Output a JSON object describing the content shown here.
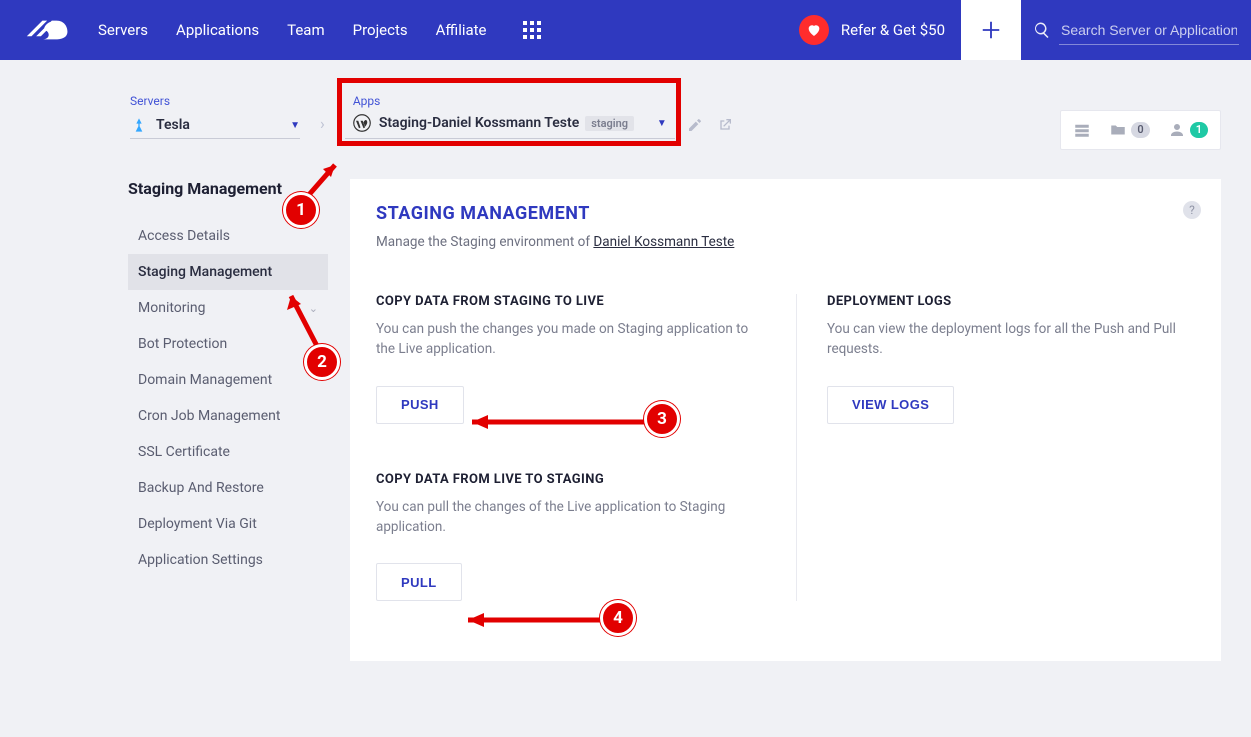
{
  "nav": {
    "links": [
      "Servers",
      "Applications",
      "Team",
      "Projects",
      "Affiliate"
    ],
    "refer_text": "Refer & Get $50",
    "search_placeholder": "Search Server or Application"
  },
  "breadcrumb": {
    "servers_label": "Servers",
    "server_name": "Tesla",
    "apps_label": "Apps",
    "app_name": "Staging-Daniel Kossmann Teste",
    "staging_tag": "staging"
  },
  "right_toolbar": {
    "projects_count": "0",
    "users_count": "1"
  },
  "sidebar": {
    "section": "Staging Management",
    "items": [
      {
        "label": "Access Details"
      },
      {
        "label": "Staging Management",
        "active": true
      },
      {
        "label": "Monitoring",
        "chevron": true
      },
      {
        "label": "Bot Protection"
      },
      {
        "label": "Domain Management"
      },
      {
        "label": "Cron Job Management"
      },
      {
        "label": "SSL Certificate"
      },
      {
        "label": "Backup And Restore"
      },
      {
        "label": "Deployment Via Git"
      },
      {
        "label": "Application Settings"
      }
    ]
  },
  "panel": {
    "title": "STAGING MANAGEMENT",
    "subtitle_prefix": "Manage the Staging environment of ",
    "subtitle_link": "Daniel Kossmann Teste",
    "push": {
      "title": "COPY DATA FROM STAGING TO LIVE",
      "desc": "You can push the changes you made on Staging application to the Live application.",
      "button": "PUSH"
    },
    "pull": {
      "title": "COPY DATA FROM LIVE TO STAGING",
      "desc": "You can pull the changes of the Live application to Staging application.",
      "button": "PULL"
    },
    "logs": {
      "title": "DEPLOYMENT LOGS",
      "desc": "You can view the deployment logs for all the Push and Pull requests.",
      "button": "VIEW LOGS"
    }
  },
  "annotations": {
    "m1": "1",
    "m2": "2",
    "m3": "3",
    "m4": "4"
  }
}
